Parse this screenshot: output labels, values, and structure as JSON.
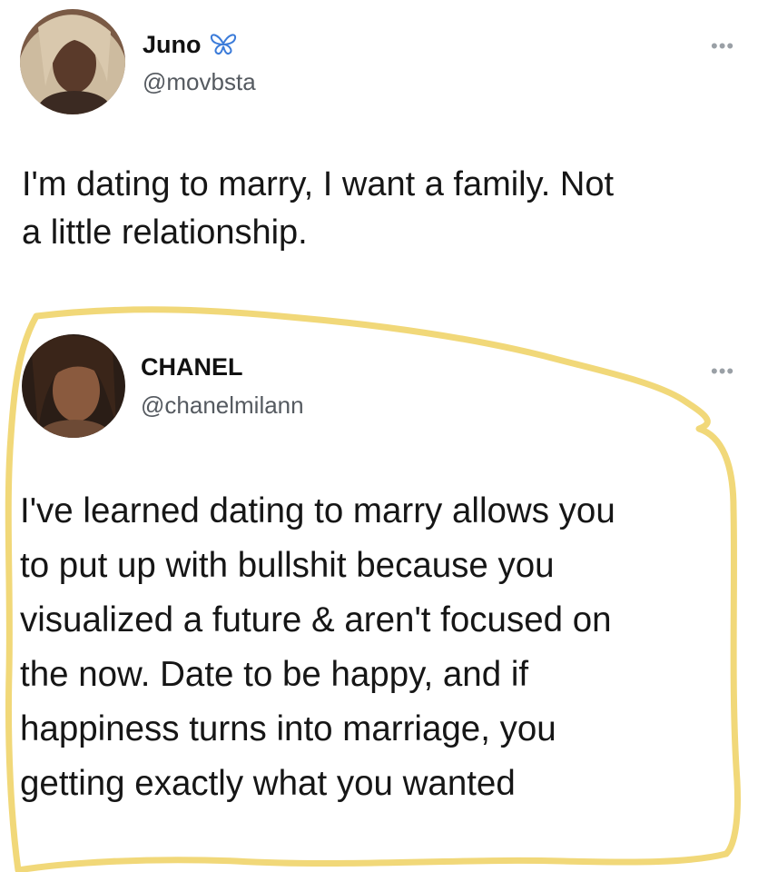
{
  "tweets": [
    {
      "name": "Juno",
      "handle": "@movbsta",
      "text": "I'm dating to marry, I want a family. Not\na little relationship.",
      "badge_icon": "butterfly-icon"
    },
    {
      "name": "CHANEL",
      "handle": "@chanelmilann",
      "text": "I've learned dating to marry allows you\nto put up with bullshit because you\nvisualized a future & aren't focused on\nthe now. Date to be happy, and if\nhappiness turns into marriage, you\ngetting exactly what you wanted"
    }
  ],
  "ui": {
    "more_glyph": "•••"
  },
  "colors": {
    "highlight": "#f0d46a",
    "butterfly": "#3b7bd9",
    "handle": "#555a60"
  }
}
